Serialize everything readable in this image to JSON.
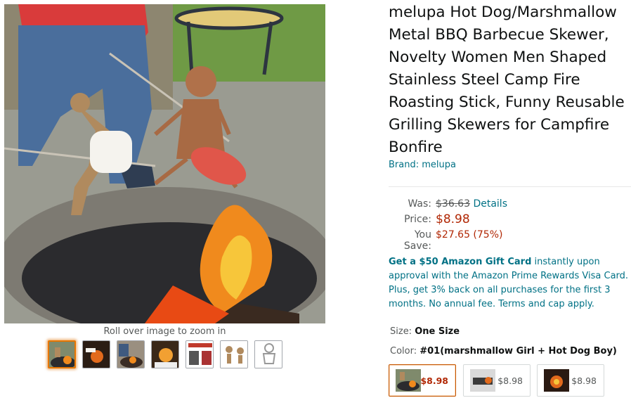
{
  "product": {
    "title": "melupa Hot Dog/Marshmallow Metal BBQ Barbecue Skewer, Novelty Women Men Shaped Stainless Steel Camp Fire Roasting Stick, Funny Reusable Grilling Skewers for Campfire Bonfire",
    "brand": "Brand: melupa"
  },
  "gallery": {
    "main_image_icon": "campfire-skewer-photo",
    "zoom_hint": "Roll over image to zoom in",
    "thumbnail_count": 7,
    "selected_thumbnail": 1
  },
  "price": {
    "was_label": "Was:",
    "was_value": "$36.63",
    "details_link": "Details",
    "price_label": "Price:",
    "price_value": "$8.98",
    "save_label": "You Save:",
    "save_value": "$27.65 (75%)"
  },
  "promo": {
    "bold": "Get a $50 Amazon Gift Card",
    "rest": " instantly upon approval with the Amazon Prime Rewards Visa Card. Plus, get 3% back on all purchases for the first 3 months. No annual fee. Terms and cap apply."
  },
  "variations": {
    "size_label": "Size: ",
    "size_value": "One Size",
    "color_label": "Color: ",
    "color_value": "#01(marshmallow Girl + Hot Dog Boy)",
    "swatches": [
      {
        "price": "$8.98",
        "selected": true
      },
      {
        "price": "$8.98",
        "selected": false
      },
      {
        "price": "$8.98",
        "selected": false
      }
    ]
  },
  "colors": {
    "link": "#007185",
    "price": "#b12704",
    "selected_border": "#e77600"
  }
}
